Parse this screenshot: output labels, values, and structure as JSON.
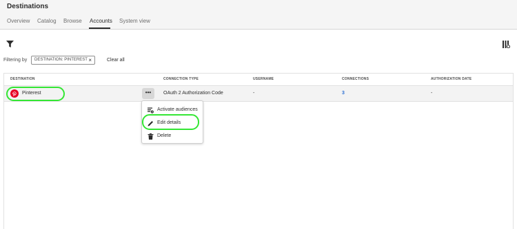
{
  "page": {
    "title": "Destinations"
  },
  "tabs": [
    {
      "label": "Overview"
    },
    {
      "label": "Catalog"
    },
    {
      "label": "Browse"
    },
    {
      "label": "Accounts"
    },
    {
      "label": "System view"
    }
  ],
  "active_tab": "Accounts",
  "toolbar": {
    "filter_icon": "filter-icon",
    "columns_icon": "column-settings-icon"
  },
  "filters": {
    "label": "Filtering by",
    "tag": "DESTINATION: PINTEREST",
    "tag_remove": "×",
    "clear_all": "Clear all"
  },
  "table": {
    "headers": [
      "DESTINATION",
      "CONNECTION TYPE",
      "USERNAME",
      "CONNECTIONS",
      "AUTHORIZATION DATE"
    ],
    "rows": [
      {
        "destination": "Pinterest",
        "destination_icon": "pinterest-icon",
        "more": "•••",
        "connection_type": "OAuth 2 Authorization Code",
        "username": "-",
        "connections": "3",
        "authorization_date": "-"
      }
    ]
  },
  "context_menu": {
    "items": [
      {
        "label": "Activate audiences",
        "icon": "activate-audiences-icon"
      },
      {
        "label": "Edit details",
        "icon": "pencil-icon"
      },
      {
        "label": "Delete",
        "icon": "trash-icon"
      }
    ]
  },
  "colors": {
    "highlight": "#33e633",
    "pinterest_red": "#e60023",
    "link_blue": "#2b6fd3"
  }
}
